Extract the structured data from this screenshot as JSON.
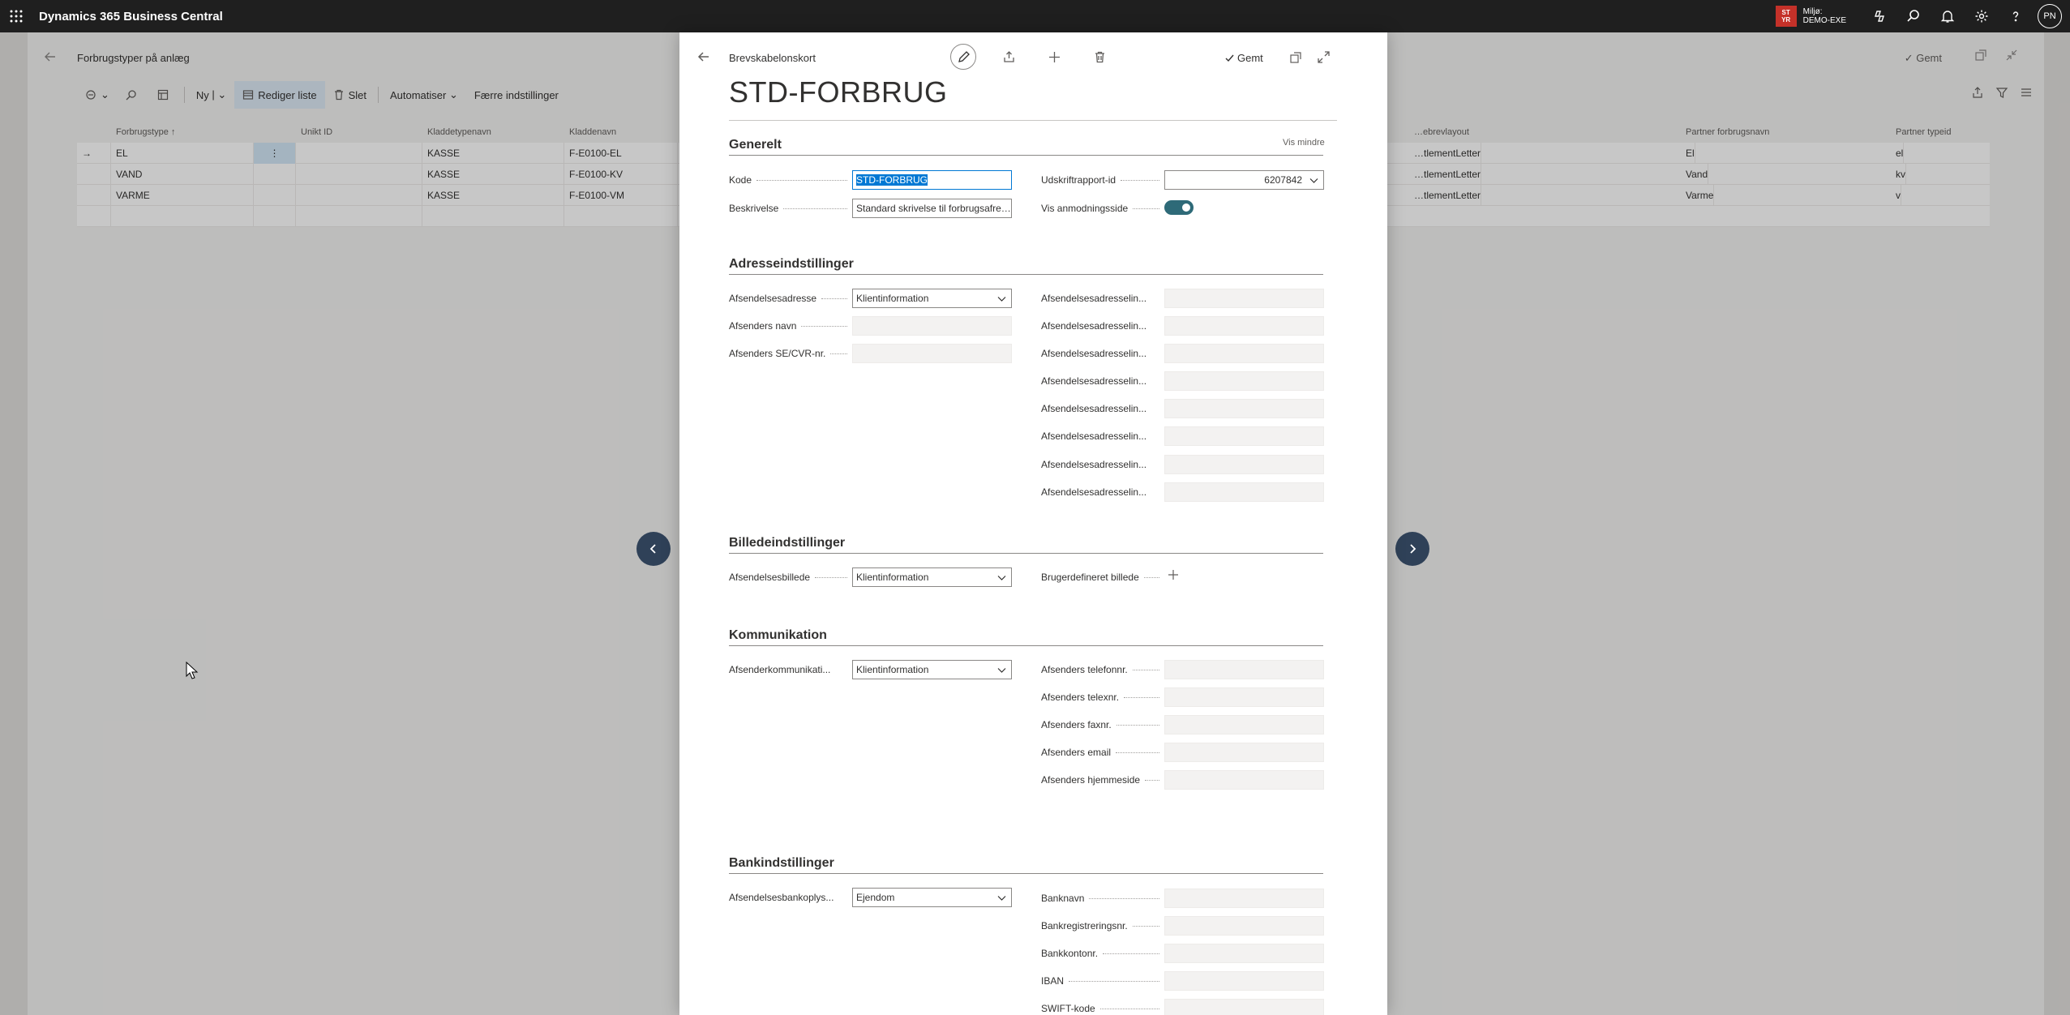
{
  "app": {
    "name": "Dynamics 365 Business Central"
  },
  "environment": {
    "badge_line1": "ST",
    "badge_line2": "YR",
    "label1": "Miljø:",
    "label2": "DEMO-EXE"
  },
  "user": {
    "initials": "PN"
  },
  "background_page": {
    "title": "Forbrugstyper på anlæg",
    "saved": "Gemt",
    "actions": {
      "new": "Ny",
      "edit_list": "Rediger liste",
      "delete": "Slet",
      "automate": "Automatiser",
      "fewer_options": "Færre indstillinger"
    },
    "columns": [
      "Forbrugstype ↑",
      "Unikt ID",
      "Kladdetypenavn",
      "Kladdenavn",
      "…ebrevlayout",
      "Partner forbrugsnavn",
      "Partner typeid"
    ],
    "rows": [
      {
        "type": "EL",
        "id": "",
        "batch_type": "KASSE",
        "batch": "F-E0100-EL",
        "layout": "…tlementLetter",
        "partner_name": "El",
        "partner_id": "el"
      },
      {
        "type": "VAND",
        "id": "",
        "batch_type": "KASSE",
        "batch": "F-E0100-KV",
        "layout": "…tlementLetter",
        "partner_name": "Vand",
        "partner_id": "kv"
      },
      {
        "type": "VARME",
        "id": "",
        "batch_type": "KASSE",
        "batch": "F-E0100-VM",
        "layout": "…tlementLetter",
        "partner_name": "Varme",
        "partner_id": "v"
      }
    ]
  },
  "card": {
    "breadcrumb": "Brevskabelonskort",
    "saved": "Gemt",
    "title": "STD-FORBRUG",
    "general": {
      "heading": "Generelt",
      "show_less": "Vis mindre",
      "code_label": "Kode",
      "code_value": "STD-FORBRUG",
      "desc_label": "Beskrivelse",
      "desc_value": "Standard skrivelse til forbrugsafre…",
      "report_label": "Udskriftrapport-id",
      "report_value": "6207842",
      "request_label": "Vis anmodningsside",
      "request_value": true
    },
    "address": {
      "heading": "Adresseindstillinger",
      "sender_addr_label": "Afsendelsesadresse",
      "sender_addr_value": "Klientinformation",
      "sender_name_label": "Afsenders navn",
      "sender_vat_label": "Afsenders SE/CVR-nr.",
      "addr_lines": [
        "Afsendelsesadresselin...",
        "Afsendelsesadresselin...",
        "Afsendelsesadresselin...",
        "Afsendelsesadresselin...",
        "Afsendelsesadresselin...",
        "Afsendelsesadresselin...",
        "Afsendelsesadresselin...",
        "Afsendelsesadresselin..."
      ]
    },
    "image": {
      "heading": "Billedeindstillinger",
      "sender_img_label": "Afsendelsesbillede",
      "sender_img_value": "Klientinformation",
      "custom_img_label": "Brugerdefineret billede"
    },
    "comm": {
      "heading": "Kommunikation",
      "sender_comm_label": "Afsenderkommunikati...",
      "sender_comm_value": "Klientinformation",
      "phone_label": "Afsenders telefonnr.",
      "telex_label": "Afsenders telexnr.",
      "fax_label": "Afsenders faxnr.",
      "email_label": "Afsenders email",
      "web_label": "Afsenders hjemmeside"
    },
    "bank": {
      "heading": "Bankindstillinger",
      "sender_bank_label": "Afsendelsesbankoplys...",
      "sender_bank_value": "Ejendom",
      "bank_name_label": "Banknavn",
      "bank_reg_label": "Bankregistreringsnr.",
      "bank_acc_label": "Bankkontonr.",
      "iban_label": "IBAN",
      "swift_label": "SWIFT-kode"
    }
  }
}
